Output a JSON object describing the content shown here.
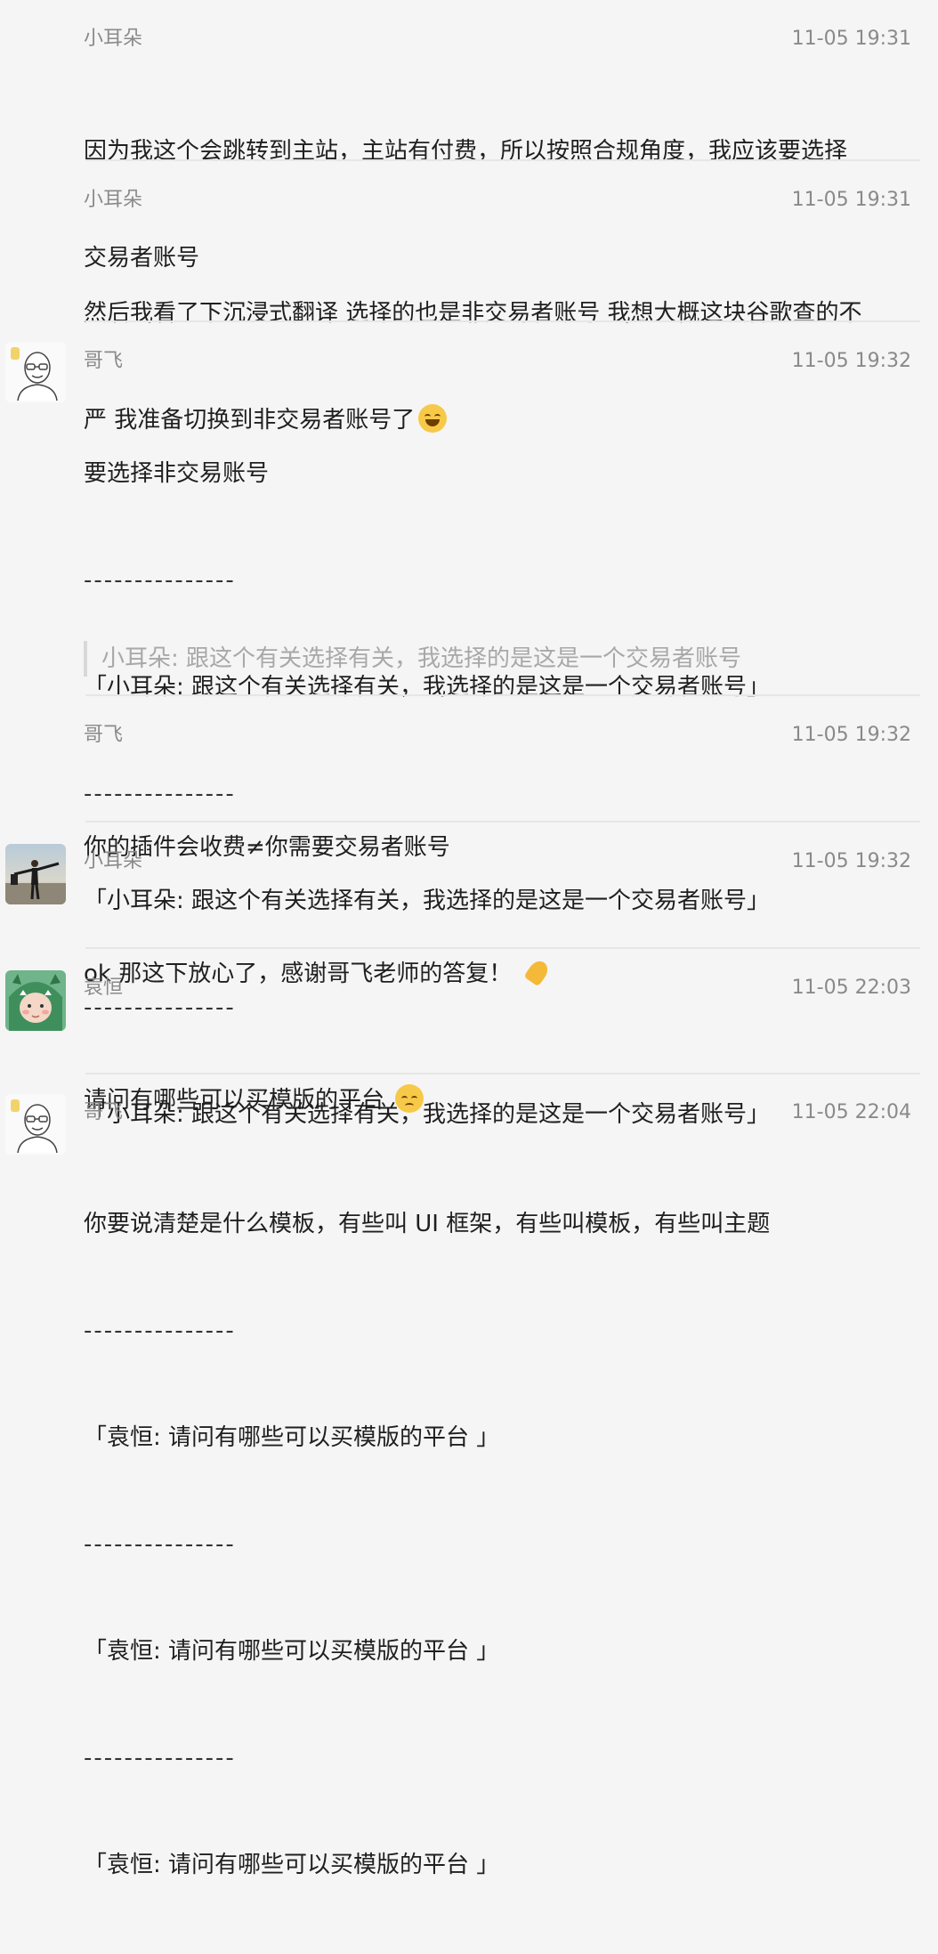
{
  "colors": {
    "background": "#f5f5f5",
    "meta_text": "#8a8a8a",
    "body_text": "#1f1f1f",
    "quote_text": "#a8a8a8",
    "divider": "#e6e6e6",
    "emoji": "#f7c948"
  },
  "messages": [
    {
      "sender": "小耳朵",
      "time": "11-05 19:31",
      "lines": [
        "因为我这个会跳转到主站，主站有付费，所以按照合规角度，我应该要选择",
        "交易者账号"
      ]
    },
    {
      "sender": "小耳朵",
      "time": "11-05 19:31",
      "lines": [
        "然后我看了下沉浸式翻译 选择的也是非交易者账号 我想大概这块谷歌查的不",
        "严 我准备切换到非交易者账号了"
      ],
      "emoji": "laughing-tears-emoji"
    },
    {
      "sender": "哥飞",
      "time": "11-05 19:32",
      "lines": [
        "要选择非交易账号",
        "---------------",
        "「小耳朵: 跟这个有关选择有关，我选择的是这是一个交易者账号」",
        "---------------",
        "「小耳朵: 跟这个有关选择有关，我选择的是这是一个交易者账号」",
        "---------------",
        "「小耳朵: 跟这个有关选择有关，我选择的是这是一个交易者账号」"
      ],
      "quote": "小耳朵: 跟这个有关选择有关，我选择的是这是一个交易者账号"
    },
    {
      "sender": "哥飞",
      "time": "11-05 19:32",
      "lines": [
        "你的插件会收费≠你需要交易者账号"
      ]
    },
    {
      "sender": "小耳朵",
      "time": "11-05 19:32",
      "lines": [
        "ok 那这下放心了，感谢哥飞老师的答复！"
      ],
      "emoji": "praying-hands-emoji"
    },
    {
      "sender": "袁恒",
      "time": "11-05 22:03",
      "lines": [
        "请问有哪些可以买模版的平台"
      ],
      "emoji": "pouting-face-emoji"
    },
    {
      "sender": "哥飞",
      "time": "11-05 22:04",
      "lines": [
        "你要说清楚是什么模板，有些叫 UI 框架，有些叫模板，有些叫主题",
        "---------------",
        "「袁恒: 请问有哪些可以买模版的平台 」",
        "---------------",
        "「袁恒: 请问有哪些可以买模版的平台 」",
        "---------------",
        "「袁恒: 请问有哪些可以买模版的平台 」"
      ]
    }
  ]
}
